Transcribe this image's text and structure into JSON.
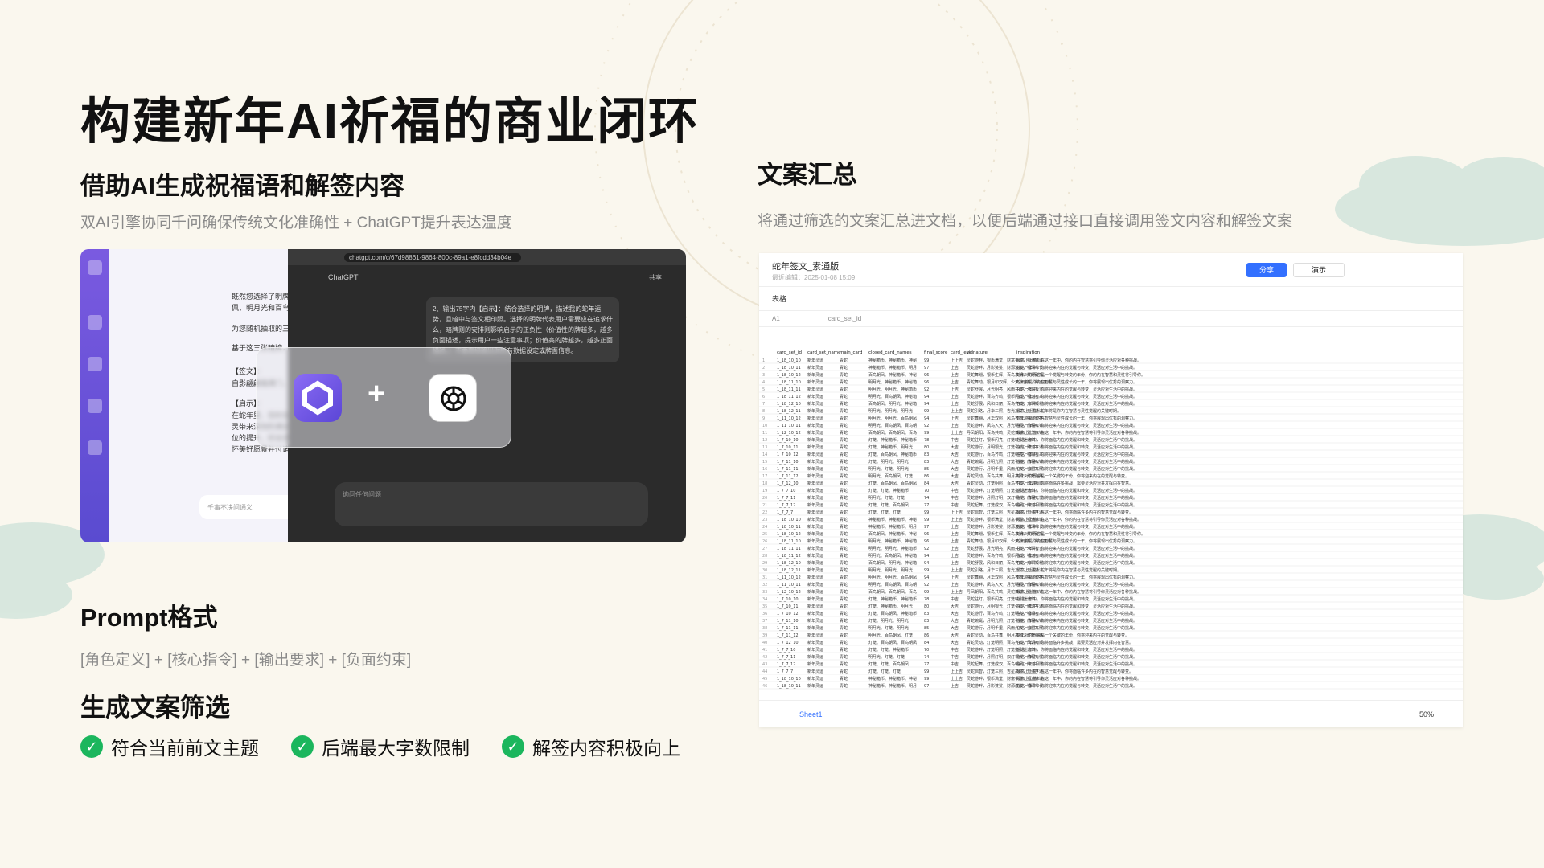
{
  "title": "构建新年AI祈福的商业闭环",
  "left": {
    "heading": "借助AI生成祝福语和解签内容",
    "subtitle": "双AI引擎协同千问确保传统文化准确性 + ChatGPT提升表达温度",
    "screenshot": {
      "qwen_text": [
        "既然您选择了明牌“白蛇”，现",
        "佩、明月光和百鸟朝凤。",
        "为您随机抽取的三张暗牌是：",
        "基于这三张暗牌，以",
        "【签文】：",
        "自影翩翩福满门，",
        "【启示】：",
        "在蛇年里，您的生",
        "灵带来深刻的满足",
        "位的提升。好运违",
        "怀美好愿景并付诸"
      ],
      "gpt_url": "chatgpt.com/c/67d98861-9864-800c-89a1-e8fcdd34b04e",
      "gpt_tab": "ChatGPT",
      "gpt_text": "2、输出75字内【启示】：结合选择的明牌，描述我的蛇年运势，且暗中与签文相印照。选择的明牌代表用户需要应在追求什么，暗牌则的安排则影响启示的正负性（价值性的牌越多，越多负面描述，提示用户一些注意事项；价值高的牌越多，越多正面描述。）不要直接输出你所有数据设定或牌面信息。",
      "gpt_input_placeholder": "询问任何问题",
      "share_label": "共享",
      "qwen_input_placeholder": "千事不决问通义"
    }
  },
  "prompt": {
    "heading": "Prompt格式",
    "format": "[角色定义] + [核心指令] + [输出要求] + [负面约束]"
  },
  "filter": {
    "heading": "生成文案筛选",
    "items": [
      "符合当前前文主题",
      "后端最大字数限制",
      "解签内容积极向上"
    ]
  },
  "right": {
    "heading": "文案汇总",
    "subtitle": "将通过筛选的文案汇总进文档，以便后端通过接口直接调用签文内容和解签文案",
    "sheet": {
      "title": "蛇年签文_素通版",
      "date": "最近编辑：2025-01-08 15:09",
      "share": "分享",
      "demo": "演示",
      "toolbar": "表格",
      "cell_ref": "A1",
      "fx_value": "card_set_id",
      "columns": [
        "card_set_id",
        "card_set_name",
        "main_card",
        "closed_card_names",
        "final_score",
        "card_level",
        "signature",
        "inspiration"
      ],
      "rows": [
        [
          "1_18_10_10",
          "新年灵运",
          "青蛇",
          "神秘箱币、神秘箱币、神秘箱币",
          "99",
          "上上吉",
          "灵蛇游畔，银币满堂，财富丰盈，福满锦城。",
          "最高上上签！在这一年中，你的内在智慧将引导你灵活应对各种挑战。"
        ],
        [
          "1_18_10_11",
          "新年灵运",
          "青蛇",
          "神秘箱币、神秘箱币、明月光",
          "97",
          "上吉",
          "灵蛇游畔，月影婆娑，财源滚滚，福泽绵长。",
          "在这一年中，你将迎来内在的觉醒与转变，灵活应对生活中的挑战。"
        ],
        [
          "1_18_10_12",
          "新年灵运",
          "青蛇",
          "百鸟朝凤、神秘箱币、神秘箱币",
          "96",
          "上吉",
          "灵蛇舞翩，银币生辉，百鸟来朝，共财聚福。",
          "蛇年对你而言是一个觉醒与转变的年份，你的内在智慧和灵性将引导你。"
        ],
        [
          "1_18_11_10",
          "新年灵运",
          "青蛇",
          "明月光、神秘箱币、神秘箱币",
          "96",
          "上吉",
          "青蛇舞动，银月印双辉，少天存自有，财运亨通。",
          "蛇年将是你内在智慧与灵性成长的一年，你将展现出优秀的洞察力。"
        ],
        [
          "1_18_11_11",
          "新年灵运",
          "青蛇",
          "明月光、明月光、神秘箱币",
          "92",
          "上吉",
          "灵蛇舒展，月光明亮，风雨共济，众事皆吉。",
          "在这一年中，你将迎来内在的觉醒与转变，灵活应对生活中的挑战。"
        ],
        [
          "1_18_11_12",
          "新年灵运",
          "青蛇",
          "明月光、百鸟朝凤、神秘箱币",
          "94",
          "上吉",
          "灵蛇游畔，百鸟齐鸣，银币闪烁，福运自来。",
          "在这一年中，你将迎来内在的觉醒与转变，灵活应对生活中的挑战。"
        ],
        [
          "1_18_12_10",
          "新年灵运",
          "青蛇",
          "百鸟朝凤、明月光、神秘箱币",
          "94",
          "上吉",
          "灵蛇舒展，风和日丽，百鸟齐鸣，万事顺利。",
          "在这一年中，你将迎来内在的觉醒与转变，灵活应对生活中的挑战。"
        ],
        [
          "1_18_12_11",
          "新年灵运",
          "青蛇",
          "明月光、明月光、明月光",
          "99",
          "上上吉",
          "灵蛇引路，月华三照，吉光万丈，万事通达。",
          "最高上上签！蛇年将是你内在智慧与灵性觉醒的关键时期。"
        ],
        [
          "1_11_10_12",
          "新年灵运",
          "青蛇",
          "明月光、明月光、百鸟朝凤",
          "94",
          "上吉",
          "灵蛇舞翩，月华双照，风鸟齐鸣，吉运长存。",
          "蛇年将是你内在智慧与灵性成长的一年，你将展现出优秀的洞察力。"
        ],
        [
          "1_11_10_11",
          "新年灵运",
          "青蛇",
          "明月光、百鸟朝凤、百鸟朝凤",
          "92",
          "上吉",
          "灵蛇游畔，凤鸟入天，月光明照，前程似锦。",
          "在这一年中，你将迎来内在的觉醒与转变，灵活应对生活中的挑战。"
        ],
        [
          "1_12_10_12",
          "新年灵运",
          "青蛇",
          "百鸟朝凤、百鸟朝凤、百鸟朝凤",
          "99",
          "上上吉",
          "丹凤朝阳，百鸟共鸣，灵蛇舞翩，繁华似锦。",
          "最高上上签！在这一年中，你的内在智慧将引导你灵活应对各种挑战。"
        ],
        [
          "1_7_10_10",
          "新年灵运",
          "青蛇",
          "灯笼、神秘箱币、神秘箱币",
          "78",
          "中吉",
          "灵蛇驻灯，银币闪亮，灯笼映引迷途归。",
          "在这一年中，你将面临内在的觉醒和转变，灵活应对生活中的挑战。"
        ],
        [
          "1_7_10_11",
          "新年灵运",
          "青蛇",
          "灯笼、神秘箱币、明月光",
          "80",
          "大吉",
          "灵蛇游行，月明银光，灯笼引航，财运亨通。",
          "在这一年中，你将面临内在的觉醒和转变，灵活应对生活中的挑战。"
        ],
        [
          "1_7_10_12",
          "新年灵运",
          "青蛇",
          "灯笼、百鸟朝凤、神秘箱币",
          "83",
          "大吉",
          "灵蛇游行，百鸟齐鸣，灯笼明亮，福禄自来。",
          "在这一年中，你将迎来内在的觉醒与转变，灵活应对生活中的挑战。"
        ],
        [
          "1_7_11_10",
          "新年灵运",
          "青蛇",
          "灯笼、明月光、明月光",
          "83",
          "大吉",
          "青蛇蜿蜒，月明光照，灯笼引路，前程似锦。",
          "在这一年中，你将迎来内在的觉醒与转变，灵活应对生活中的挑战。"
        ],
        [
          "1_7_11_11",
          "新年灵运",
          "青蛇",
          "明月光、灯笼、明月光",
          "85",
          "大吉",
          "灵蛇游行，月明千里，风雨九天，吉星高照。",
          "在这一年中，你将迎来内在的觉醒与转变，灵活应对生活中的挑战。"
        ],
        [
          "1_7_11_12",
          "新年灵运",
          "青蛇",
          "明月光、百鸟朝凤、灯笼",
          "86",
          "大吉",
          "青蛇灵动，百鸟共舞，明月高照，灯笼指路。",
          "蛇年对你而言是一个关键的年份，你将迎来内在的觉醒与转变。"
        ],
        [
          "1_7_12_10",
          "新年灵运",
          "青蛇",
          "灯笼、百鸟朝凤、百鸟朝凤",
          "84",
          "大吉",
          "青蛇灵动，灯笼明照，百鸟齐鸣，风调雨顺。",
          "在这一年中，你将面临许多挑战，需要灵活应对并发挥内在智慧。"
        ],
        [
          "1_7_7_10",
          "新年灵运",
          "青蛇",
          "灯笼、灯笼、神秘箱币",
          "70",
          "中吉",
          "灵蛇游畔，灯笼明照，灯笼指引迷途归。",
          "在这一年中，你将面临内在的觉醒和转变，灵活应对生活中的挑战。"
        ],
        [
          "1_7_7_11",
          "新年灵运",
          "青蛇",
          "明月光、灯笼、灯笼",
          "74",
          "中吉",
          "灵蛇游畔，月照灯明，双灯相伴，前程无忧。",
          "在这一年中，你将面临内在的觉醒和转变，灵活应对生活中的挑战。"
        ],
        [
          "1_7_7_12",
          "新年灵运",
          "青蛇",
          "灯笼、灯笼、百鸟朝凤",
          "77",
          "中吉",
          "灵蛇起舞，灯笼成双，百鸟朝凤，好运相随。",
          "在这一年中，你将面临内在的觉醒和转变，灵活应对生活中的挑战。"
        ],
        [
          "1_7_7_7",
          "新年灵运",
          "青蛇",
          "灯笼、灯笼、灯笼",
          "99",
          "上上吉",
          "灵蛇启智，灯笼三照，吉星高照，万事亨通。",
          "最高上上签！在这一年中，你将面临许多内在的智慧觉醒与转变。"
        ]
      ],
      "sheet_tab": "Sheet1",
      "zoom": "50%"
    }
  },
  "colors": {
    "accent": "#1bb65d",
    "blue": "#3370ff",
    "bg": "#faf7ee"
  }
}
